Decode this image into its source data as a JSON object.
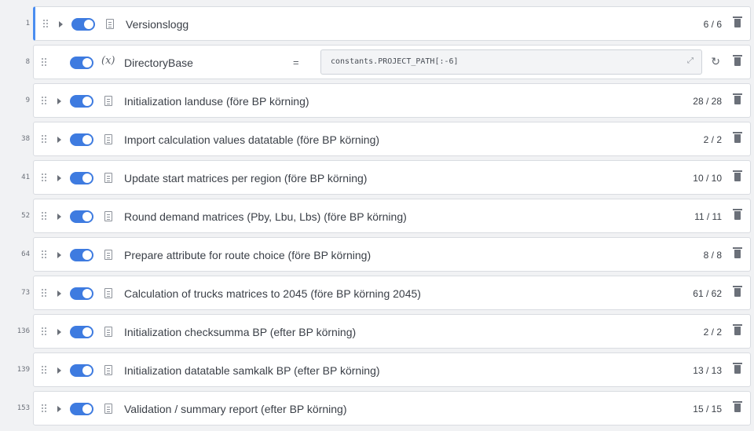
{
  "rows": [
    {
      "line": "1",
      "title": "Versionslogg",
      "count": "6 / 6",
      "type": "group",
      "active": true
    },
    {
      "line": "8",
      "title": "DirectoryBase",
      "type": "variable",
      "equals": "=",
      "expression": "constants.PROJECT_PATH[:-6]"
    },
    {
      "line": "9",
      "title": "Initialization landuse (före BP körning)",
      "count": "28 / 28",
      "type": "group"
    },
    {
      "line": "38",
      "title": "Import calculation values datatable (före BP körning)",
      "count": "2 / 2",
      "type": "group"
    },
    {
      "line": "41",
      "title": "Update start matrices per region (före BP körning)",
      "count": "10 / 10",
      "type": "group"
    },
    {
      "line": "52",
      "title": "Round demand matrices (Pby, Lbu, Lbs) (före BP körning)",
      "count": "11 / 11",
      "type": "group"
    },
    {
      "line": "64",
      "title": "Prepare attribute for route choice (före BP körning)",
      "count": "8 / 8",
      "type": "group"
    },
    {
      "line": "73",
      "title": "Calculation of trucks matrices to 2045 (före BP körning 2045)",
      "count": "61 / 62",
      "type": "group"
    },
    {
      "line": "136",
      "title": "Initialization checksumma BP (efter BP körning)",
      "count": "2 / 2",
      "type": "group"
    },
    {
      "line": "139",
      "title": "Initialization datatable samkalk BP (efter BP körning)",
      "count": "13 / 13",
      "type": "group"
    },
    {
      "line": "153",
      "title": "Validation / summary report (efter BP körning)",
      "count": "15 / 15",
      "type": "group"
    }
  ],
  "icons": {
    "drag": "drag-handle-icon",
    "expand": "caret-right-icon",
    "toggle": "toggle-on",
    "group": "document-icon",
    "variable": "variable-x-icon",
    "delete": "trash-icon",
    "refresh": "refresh-icon",
    "fullscreen": "expand-icon"
  },
  "colors": {
    "accent": "#3e7be0",
    "active_border": "#4a8df0",
    "background": "#f1f2f4"
  }
}
